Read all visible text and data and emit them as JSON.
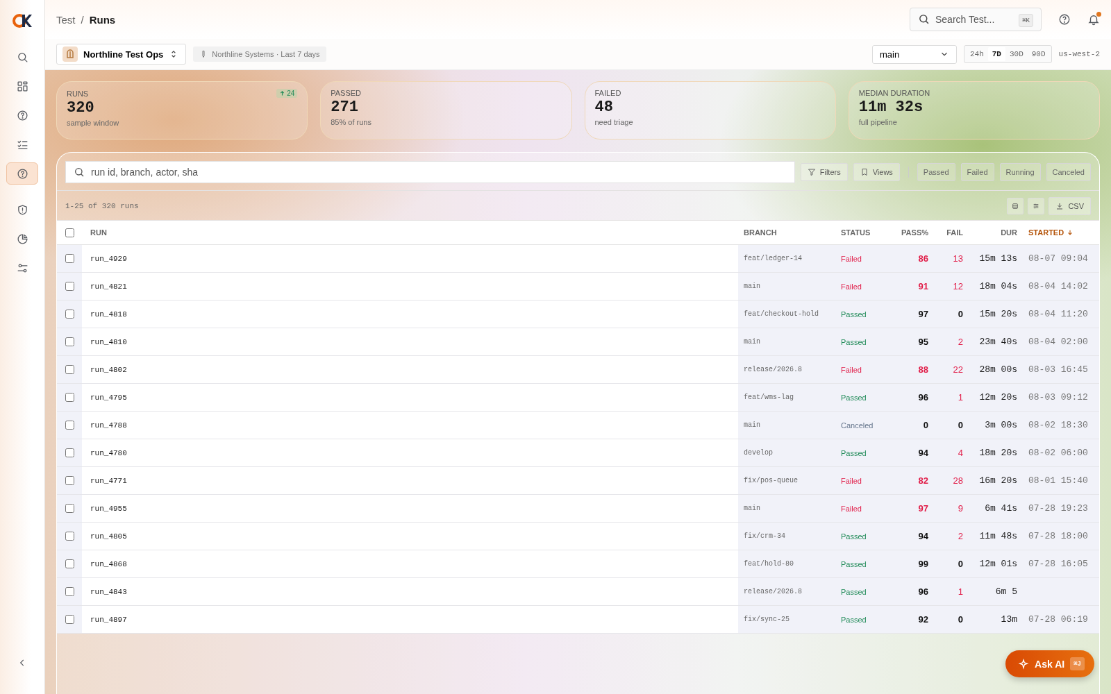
{
  "sidebar": {
    "items": [
      {
        "selected": false
      },
      {
        "selected": false
      },
      {
        "selected": false
      },
      {
        "selected": false
      },
      {
        "selected": true
      },
      {
        "selected": false
      },
      {
        "selected": false
      },
      {
        "selected": false
      }
    ]
  },
  "header": {
    "breadcrumb": [
      "Test",
      "Runs"
    ],
    "separator": "/",
    "search": {
      "placeholder": "Search Test...",
      "shortcut": "⌘K"
    },
    "notifications": {
      "unread": true
    }
  },
  "context": {
    "workspace": "Northline Test Ops",
    "scope": "Northline Systems · Last 7 days",
    "branch": "main",
    "ranges": [
      {
        "label": "24h",
        "selected": false
      },
      {
        "label": "7D",
        "selected": true
      },
      {
        "label": "30D",
        "selected": false
      },
      {
        "label": "90D",
        "selected": false
      }
    ],
    "region": "us-west-2"
  },
  "stats": [
    {
      "label": "RUNS",
      "value": "320",
      "sub": "sample window",
      "delta": "24"
    },
    {
      "label": "PASSED",
      "value": "271",
      "sub": "85% of runs"
    },
    {
      "label": "FAILED",
      "value": "48",
      "sub": "need triage"
    },
    {
      "label": "MEDIAN DURATION",
      "value": "11m 32s",
      "sub": "full pipeline"
    }
  ],
  "toolbar": {
    "search": {
      "placeholder": "run id, branch, actor, sha"
    },
    "filters": "Filters",
    "views": "Views",
    "status_filters": [
      {
        "label": "Passed",
        "selected": false
      },
      {
        "label": "Failed",
        "selected": false
      },
      {
        "label": "Running",
        "selected": false
      },
      {
        "label": "Canceled",
        "selected": false
      }
    ],
    "count": "1-25 of 320 runs",
    "export": "CSV"
  },
  "table": {
    "select_all": {
      "checked": false
    },
    "columns": [
      {
        "label": "RUN",
        "sorted": false
      },
      {
        "label": "BRANCH",
        "sorted": false
      },
      {
        "label": "STATUS",
        "sorted": false
      },
      {
        "label": "PASS%",
        "sorted": false
      },
      {
        "label": "FAIL",
        "sorted": false
      },
      {
        "label": "DUR",
        "sorted": false
      },
      {
        "label": "STARTED",
        "sorted": true
      }
    ],
    "rows": [
      {
        "selected": false,
        "run": "run_4929",
        "branch": "feat/ledger-14",
        "status": "Failed",
        "kind": "failed",
        "pass": "86",
        "fail": "13",
        "dur": "15m 13s",
        "started": "08-07 09:04"
      },
      {
        "selected": false,
        "run": "run_4821",
        "branch": "main",
        "status": "Failed",
        "kind": "failed",
        "pass": "91",
        "fail": "12",
        "dur": "18m 04s",
        "started": "08-04 14:02"
      },
      {
        "selected": false,
        "run": "run_4818",
        "branch": "feat/checkout-hold",
        "status": "Passed",
        "kind": "passed",
        "pass": "97",
        "fail": "0",
        "dur": "15m 20s",
        "started": "08-04 11:20"
      },
      {
        "selected": false,
        "run": "run_4810",
        "branch": "main",
        "status": "Passed",
        "kind": "passed",
        "pass": "95",
        "fail": "2",
        "dur": "23m 40s",
        "started": "08-04 02:00"
      },
      {
        "selected": false,
        "run": "run_4802",
        "branch": "release/2026.8",
        "status": "Failed",
        "kind": "failed",
        "pass": "88",
        "fail": "22",
        "dur": "28m 00s",
        "started": "08-03 16:45"
      },
      {
        "selected": false,
        "run": "run_4795",
        "branch": "feat/wms-lag",
        "status": "Passed",
        "kind": "passed",
        "pass": "96",
        "fail": "1",
        "dur": "12m 20s",
        "started": "08-03 09:12"
      },
      {
        "selected": false,
        "run": "run_4788",
        "branch": "main",
        "status": "Canceled",
        "kind": "canceled",
        "pass": "0",
        "fail": "0",
        "dur": "3m 00s",
        "started": "08-02 18:30"
      },
      {
        "selected": false,
        "run": "run_4780",
        "branch": "develop",
        "status": "Passed",
        "kind": "passed",
        "pass": "94",
        "fail": "4",
        "dur": "18m 20s",
        "started": "08-02 06:00"
      },
      {
        "selected": false,
        "run": "run_4771",
        "branch": "fix/pos-queue",
        "status": "Failed",
        "kind": "failed",
        "pass": "82",
        "fail": "28",
        "dur": "16m 20s",
        "started": "08-01 15:40"
      },
      {
        "selected": false,
        "run": "run_4955",
        "branch": "main",
        "status": "Failed",
        "kind": "failed",
        "pass": "97",
        "fail": "9",
        "dur": "6m 41s",
        "started": "07-28 19:23"
      },
      {
        "selected": false,
        "run": "run_4805",
        "branch": "fix/crm-34",
        "status": "Passed",
        "kind": "passed",
        "pass": "94",
        "fail": "2",
        "dur": "11m 48s",
        "started": "07-28 18:00"
      },
      {
        "selected": false,
        "run": "run_4868",
        "branch": "feat/hold-80",
        "status": "Passed",
        "kind": "passed",
        "pass": "99",
        "fail": "0",
        "dur": "12m 01s",
        "started": "07-28 16:05"
      },
      {
        "selected": false,
        "run": "run_4843",
        "branch": "release/2026.8",
        "status": "Passed",
        "kind": "passed",
        "pass": "96",
        "fail": "1",
        "dur": "6m 5"
      },
      {
        "selected": false,
        "run": "run_4897",
        "branch": "fix/sync-25",
        "status": "Passed",
        "kind": "passed",
        "pass": "92",
        "fail": "0",
        "dur": "13m",
        "started": "07-28 06:19"
      }
    ]
  },
  "assistant": {
    "label": "Ask AI",
    "shortcut": "⌘J"
  }
}
